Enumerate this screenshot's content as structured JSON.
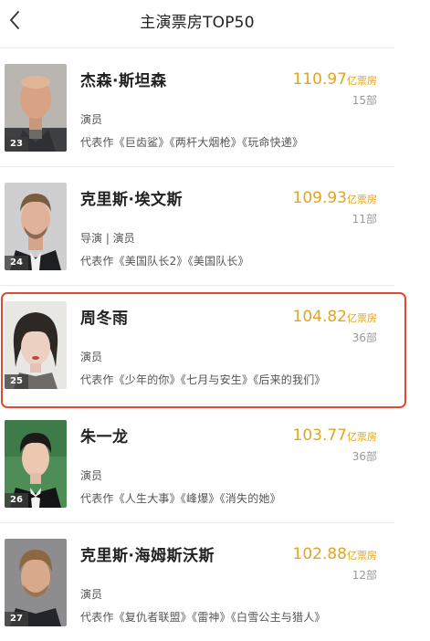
{
  "header": {
    "title": "主演票房TOP50"
  },
  "icons": {
    "back": "chevron-left-icon"
  },
  "colors": {
    "box_office": "#e0a526",
    "highlight": "#e04a2f",
    "rank_badge": "#3c3c3c"
  },
  "box_unit": "亿票房",
  "actors": [
    {
      "rank": "23",
      "name": "杰森·斯坦森",
      "box_office": "110.97",
      "count": "15部",
      "role": "演员",
      "works": "代表作《巨齿鲨》《两杆大烟枪》《玩命快递》"
    },
    {
      "rank": "24",
      "name": "克里斯·埃文斯",
      "box_office": "109.93",
      "count": "11部",
      "role": "导演 | 演员",
      "works": "代表作《美国队长2》《美国队长》"
    },
    {
      "rank": "25",
      "name": "周冬雨",
      "box_office": "104.82",
      "count": "36部",
      "role": "演员",
      "works": "代表作《少年的你》《七月与安生》《后来的我们》"
    },
    {
      "rank": "26",
      "name": "朱一龙",
      "box_office": "103.77",
      "count": "36部",
      "role": "演员",
      "works": "代表作《人生大事》《峰爆》《消失的她》"
    },
    {
      "rank": "27",
      "name": "克里斯·海姆斯沃斯",
      "box_office": "102.88",
      "count": "12部",
      "role": "演员",
      "works": "代表作《复仇者联盟》《雷神》《白雪公主与猎人》"
    }
  ]
}
